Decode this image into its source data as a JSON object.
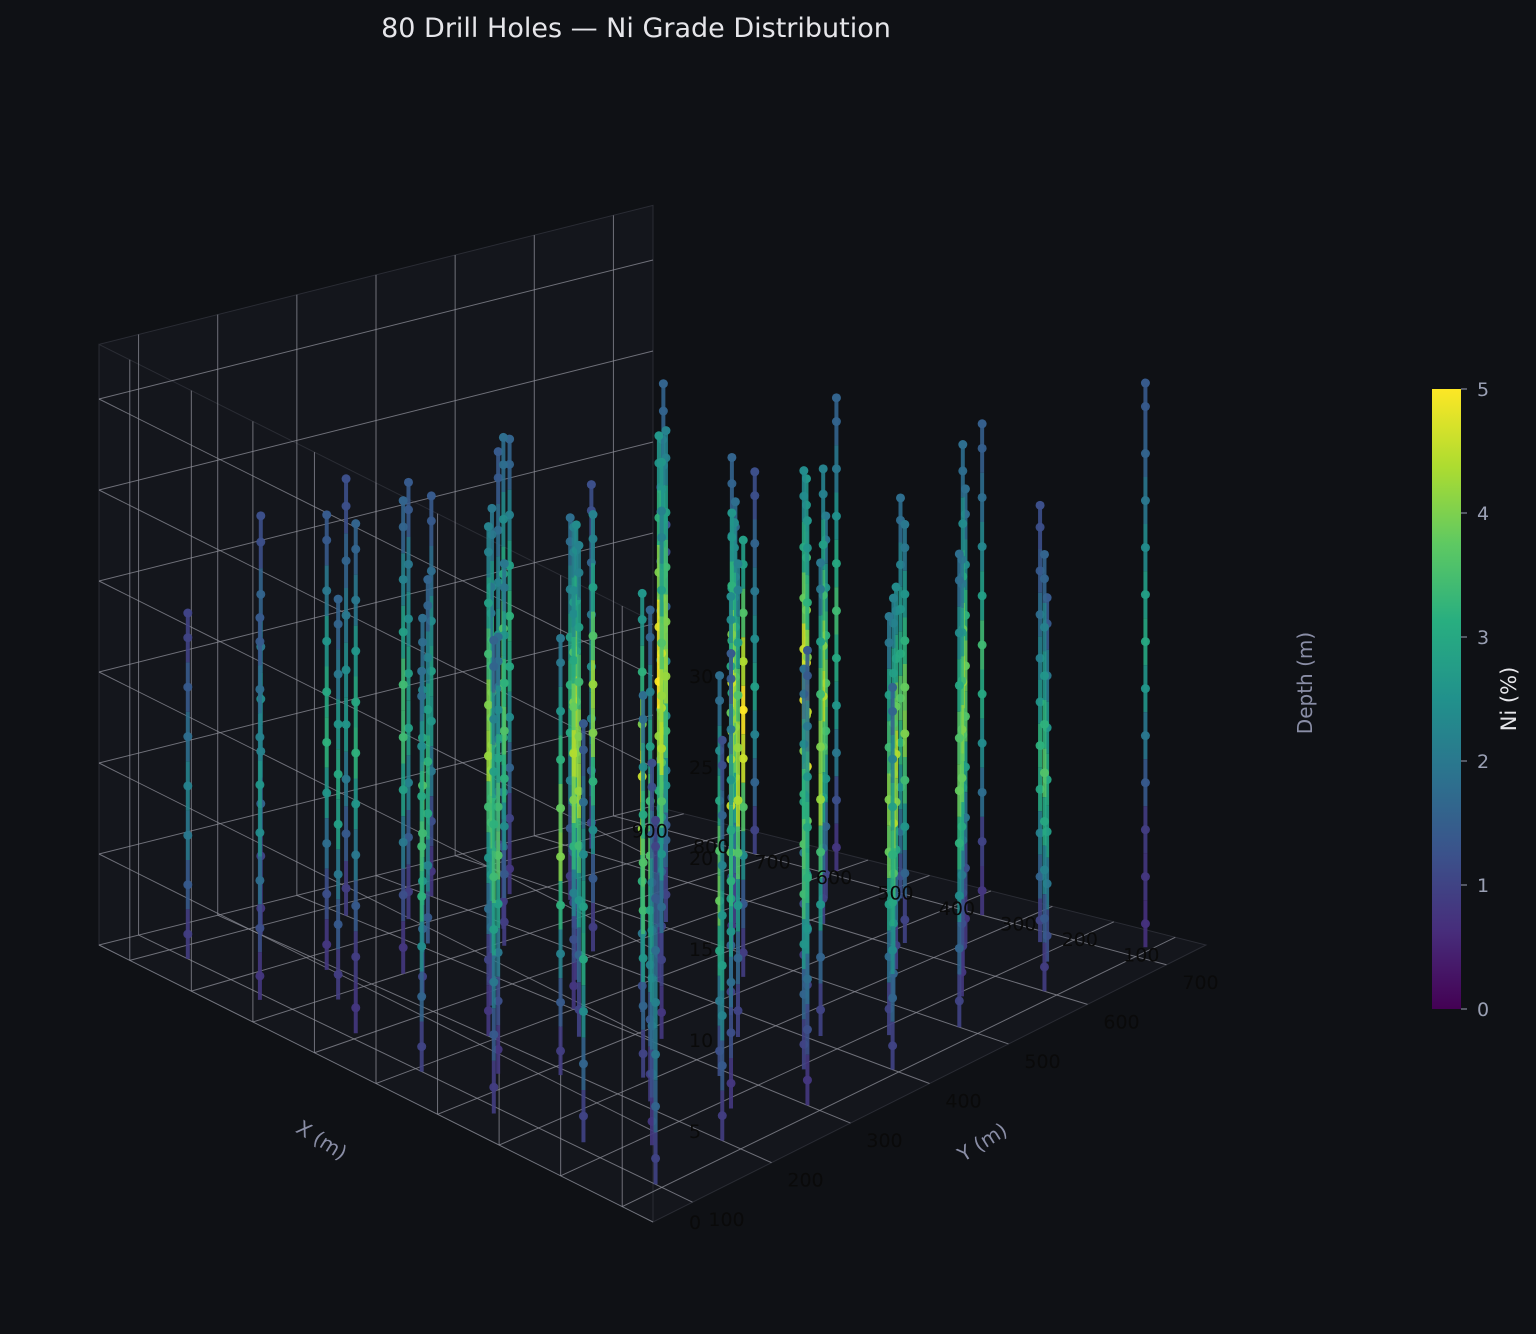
{
  "chart_data": {
    "type": "scatter",
    "title": "80 Drill Holes — Ni Grade Distribution",
    "xlabel": "X (m)",
    "ylabel": "Y (m)",
    "zlabel": "Depth (m)",
    "x_ticks": [
      "100",
      "200",
      "300",
      "400",
      "500",
      "600",
      "700",
      "800",
      "900"
    ],
    "y_ticks": [
      "100",
      "200",
      "300",
      "400",
      "500",
      "600",
      "700"
    ],
    "z_ticks": [
      "0",
      "5",
      "10",
      "15",
      "20",
      "25",
      "30"
    ],
    "xlim": [
      50,
      950
    ],
    "ylim": [
      50,
      750
    ],
    "zlim": [
      0,
      33
    ],
    "grid": true,
    "colormap": "viridis",
    "colorbar": {
      "label": "Ni (%)",
      "ticks": [
        "0",
        "1",
        "2",
        "3",
        "4",
        "5"
      ],
      "range": [
        0,
        5
      ]
    },
    "holes": [
      {
        "x": 110,
        "y": 720,
        "depth": 31,
        "ni": [
          1.4,
          1.6,
          2.0,
          2.4,
          2.8,
          3.0,
          2.6,
          2.0,
          1.4,
          0.9,
          0.8,
          0.7
        ]
      },
      {
        "x": 230,
        "y": 680,
        "depth": 24,
        "ni": [
          1.2,
          1.4,
          1.8,
          2.2,
          2.6,
          3.2,
          3.0,
          2.2,
          1.6,
          1.0
        ]
      },
      {
        "x": 350,
        "y": 700,
        "depth": 27,
        "ni": [
          1.5,
          1.8,
          2.3,
          2.8,
          3.4,
          3.0,
          2.4,
          1.8,
          1.0,
          0.8
        ]
      },
      {
        "x": 470,
        "y": 690,
        "depth": 22,
        "ni": [
          1.8,
          2.2,
          2.6,
          3.0,
          3.6,
          3.2,
          2.5,
          1.8,
          1.2
        ]
      },
      {
        "x": 600,
        "y": 710,
        "depth": 26,
        "ni": [
          1.6,
          2.0,
          2.5,
          3.0,
          3.4,
          3.0,
          2.6,
          2.0,
          1.2,
          0.8
        ]
      },
      {
        "x": 720,
        "y": 700,
        "depth": 21,
        "ni": [
          1.2,
          1.6,
          2.0,
          2.4,
          2.8,
          2.2,
          1.6,
          1.0
        ]
      },
      {
        "x": 860,
        "y": 690,
        "depth": 19,
        "ni": [
          1.0,
          1.4,
          1.8,
          2.2,
          2.0,
          1.6,
          1.0
        ]
      },
      {
        "x": 120,
        "y": 600,
        "depth": 24,
        "ni": [
          1.6,
          2.2,
          2.6,
          3.2,
          3.6,
          3.0,
          2.2,
          1.4,
          0.9
        ]
      },
      {
        "x": 240,
        "y": 590,
        "depth": 29,
        "ni": [
          1.8,
          2.4,
          3.0,
          3.8,
          4.2,
          3.6,
          2.8,
          2.0,
          1.2,
          0.9
        ]
      },
      {
        "x": 360,
        "y": 610,
        "depth": 23,
        "ni": [
          2.0,
          2.6,
          3.2,
          3.8,
          4.0,
          3.4,
          2.6,
          1.6,
          1.0
        ]
      },
      {
        "x": 480,
        "y": 600,
        "depth": 25,
        "ni": [
          2.2,
          2.8,
          3.4,
          4.0,
          4.4,
          3.6,
          2.8,
          1.8,
          1.0
        ]
      },
      {
        "x": 610,
        "y": 590,
        "depth": 22,
        "ni": [
          1.8,
          2.4,
          3.0,
          3.6,
          3.8,
          3.0,
          2.2,
          1.2
        ]
      },
      {
        "x": 740,
        "y": 600,
        "depth": 27,
        "ni": [
          1.6,
          2.0,
          2.6,
          3.2,
          3.4,
          2.8,
          2.0,
          1.4,
          0.9
        ]
      },
      {
        "x": 870,
        "y": 610,
        "depth": 20,
        "ni": [
          1.2,
          1.6,
          2.0,
          2.4,
          2.2,
          1.6,
          1.0
        ]
      },
      {
        "x": 130,
        "y": 500,
        "depth": 26,
        "ni": [
          1.8,
          2.4,
          3.0,
          3.6,
          3.8,
          3.2,
          2.4,
          1.6,
          1.0
        ]
      },
      {
        "x": 250,
        "y": 510,
        "depth": 22,
        "ni": [
          2.2,
          2.8,
          3.6,
          4.2,
          4.4,
          3.6,
          2.6,
          1.6
        ]
      },
      {
        "x": 370,
        "y": 490,
        "depth": 28,
        "ni": [
          2.4,
          3.0,
          3.8,
          4.6,
          4.8,
          4.0,
          3.0,
          2.0,
          1.2,
          0.9
        ]
      },
      {
        "x": 500,
        "y": 500,
        "depth": 24,
        "ni": [
          2.6,
          3.2,
          4.0,
          4.6,
          4.2,
          3.4,
          2.4,
          1.4,
          0.9
        ]
      },
      {
        "x": 620,
        "y": 510,
        "depth": 27,
        "ni": [
          2.2,
          2.8,
          3.4,
          4.0,
          4.2,
          3.4,
          2.6,
          1.6,
          1.0
        ]
      },
      {
        "x": 750,
        "y": 490,
        "depth": 21,
        "ni": [
          1.8,
          2.2,
          2.8,
          3.2,
          3.0,
          2.2,
          1.4,
          0.9
        ]
      },
      {
        "x": 880,
        "y": 500,
        "depth": 23,
        "ni": [
          1.4,
          1.8,
          2.2,
          2.6,
          2.4,
          1.8,
          1.2,
          0.8
        ]
      },
      {
        "x": 110,
        "y": 400,
        "depth": 21,
        "ni": [
          1.6,
          2.2,
          2.8,
          3.2,
          3.0,
          2.4,
          1.6,
          1.0
        ]
      },
      {
        "x": 240,
        "y": 410,
        "depth": 26,
        "ni": [
          2.0,
          2.8,
          3.4,
          4.0,
          4.2,
          3.4,
          2.6,
          1.6,
          1.0
        ]
      },
      {
        "x": 360,
        "y": 390,
        "depth": 23,
        "ni": [
          2.4,
          3.0,
          3.8,
          4.4,
          4.6,
          3.8,
          2.8,
          1.6,
          1.0
        ]
      },
      {
        "x": 490,
        "y": 400,
        "depth": 30,
        "ni": [
          2.6,
          3.2,
          4.0,
          4.8,
          5.0,
          4.2,
          3.2,
          2.2,
          1.4,
          0.9
        ]
      },
      {
        "x": 610,
        "y": 410,
        "depth": 24,
        "ni": [
          2.2,
          2.8,
          3.6,
          4.2,
          4.0,
          3.2,
          2.4,
          1.4,
          0.9
        ]
      },
      {
        "x": 730,
        "y": 390,
        "depth": 27,
        "ni": [
          1.8,
          2.4,
          3.0,
          3.6,
          3.8,
          3.0,
          2.2,
          1.4,
          0.9
        ]
      },
      {
        "x": 860,
        "y": 400,
        "depth": 22,
        "ni": [
          1.4,
          1.8,
          2.4,
          2.8,
          2.6,
          2.0,
          1.2,
          0.8
        ]
      },
      {
        "x": 120,
        "y": 300,
        "depth": 25,
        "ni": [
          1.4,
          2.0,
          2.6,
          3.0,
          3.2,
          2.6,
          1.8,
          1.2,
          0.8
        ]
      },
      {
        "x": 250,
        "y": 290,
        "depth": 22,
        "ni": [
          1.8,
          2.4,
          3.0,
          3.6,
          3.8,
          3.0,
          2.0,
          1.2
        ]
      },
      {
        "x": 370,
        "y": 310,
        "depth": 29,
        "ni": [
          2.2,
          2.8,
          3.6,
          4.2,
          4.4,
          3.6,
          2.6,
          1.8,
          1.0,
          0.8
        ]
      },
      {
        "x": 500,
        "y": 300,
        "depth": 23,
        "ni": [
          2.4,
          3.0,
          3.8,
          4.4,
          4.0,
          3.2,
          2.2,
          1.2,
          0.8
        ]
      },
      {
        "x": 620,
        "y": 290,
        "depth": 26,
        "ni": [
          2.0,
          2.6,
          3.2,
          3.8,
          4.0,
          3.2,
          2.4,
          1.6,
          1.0
        ]
      },
      {
        "x": 750,
        "y": 310,
        "depth": 20,
        "ni": [
          1.6,
          2.2,
          2.8,
          3.2,
          3.0,
          2.2,
          1.4
        ]
      },
      {
        "x": 870,
        "y": 300,
        "depth": 24,
        "ni": [
          1.2,
          1.6,
          2.0,
          2.4,
          2.6,
          2.0,
          1.4,
          0.9
        ]
      },
      {
        "x": 130,
        "y": 200,
        "depth": 22,
        "ni": [
          1.2,
          1.6,
          2.2,
          2.6,
          2.8,
          2.2,
          1.4,
          0.9
        ]
      },
      {
        "x": 260,
        "y": 210,
        "depth": 27,
        "ni": [
          1.6,
          2.2,
          2.8,
          3.4,
          3.6,
          3.0,
          2.2,
          1.4,
          0.9
        ]
      },
      {
        "x": 380,
        "y": 190,
        "depth": 24,
        "ni": [
          2.0,
          2.6,
          3.2,
          3.8,
          4.0,
          3.2,
          2.2,
          1.4,
          0.9
        ]
      },
      {
        "x": 510,
        "y": 200,
        "depth": 28,
        "ni": [
          2.2,
          2.8,
          3.4,
          4.0,
          4.2,
          3.4,
          2.6,
          1.8,
          1.0,
          0.8
        ]
      },
      {
        "x": 630,
        "y": 210,
        "depth": 21,
        "ni": [
          1.8,
          2.4,
          3.0,
          3.6,
          3.4,
          2.6,
          1.6,
          1.0
        ]
      },
      {
        "x": 760,
        "y": 190,
        "depth": 25,
        "ni": [
          1.4,
          2.0,
          2.6,
          3.0,
          3.2,
          2.6,
          1.8,
          1.2,
          0.8
        ]
      },
      {
        "x": 880,
        "y": 200,
        "depth": 23,
        "ni": [
          1.2,
          1.6,
          2.0,
          2.4,
          2.2,
          1.6,
          1.0,
          0.8
        ]
      },
      {
        "x": 110,
        "y": 100,
        "depth": 20,
        "ni": [
          1.0,
          1.4,
          1.8,
          2.2,
          2.0,
          1.6,
          1.0
        ]
      },
      {
        "x": 240,
        "y": 110,
        "depth": 23,
        "ni": [
          1.4,
          1.8,
          2.4,
          2.8,
          3.0,
          2.4,
          1.6,
          1.0
        ]
      },
      {
        "x": 360,
        "y": 90,
        "depth": 26,
        "ni": [
          1.6,
          2.2,
          2.8,
          3.2,
          3.4,
          2.8,
          2.0,
          1.4,
          0.9
        ]
      },
      {
        "x": 490,
        "y": 100,
        "depth": 22,
        "ni": [
          1.8,
          2.4,
          3.0,
          3.4,
          3.2,
          2.4,
          1.6,
          1.0
        ]
      },
      {
        "x": 610,
        "y": 110,
        "depth": 28,
        "ni": [
          1.6,
          2.0,
          2.6,
          3.0,
          3.2,
          2.6,
          2.0,
          1.4,
          0.9,
          0.8
        ]
      },
      {
        "x": 740,
        "y": 90,
        "depth": 21,
        "ni": [
          1.4,
          1.8,
          2.2,
          2.6,
          2.4,
          1.8,
          1.2,
          0.8
        ]
      },
      {
        "x": 870,
        "y": 100,
        "depth": 19,
        "ni": [
          1.0,
          1.4,
          1.8,
          2.2,
          2.0,
          1.4,
          0.9
        ]
      },
      {
        "x": 180,
        "y": 650,
        "depth": 20,
        "ni": [
          1.4,
          2.0,
          2.6,
          3.0,
          2.8,
          2.0,
          1.2
        ]
      },
      {
        "x": 300,
        "y": 640,
        "depth": 25,
        "ni": [
          1.8,
          2.4,
          3.2,
          3.8,
          3.6,
          2.8,
          2.0,
          1.2,
          0.8
        ]
      },
      {
        "x": 540,
        "y": 650,
        "depth": 21,
        "ni": [
          2.0,
          2.6,
          3.2,
          3.6,
          3.4,
          2.6,
          1.6,
          1.0
        ]
      },
      {
        "x": 680,
        "y": 640,
        "depth": 23,
        "ni": [
          1.6,
          2.2,
          2.8,
          3.2,
          3.0,
          2.2,
          1.4,
          0.9
        ]
      },
      {
        "x": 800,
        "y": 650,
        "depth": 18,
        "ni": [
          1.2,
          1.6,
          2.2,
          2.4,
          2.0,
          1.4
        ]
      },
      {
        "x": 190,
        "y": 550,
        "depth": 24,
        "ni": [
          2.0,
          2.6,
          3.4,
          4.0,
          3.8,
          3.0,
          2.0,
          1.2,
          0.8
        ]
      },
      {
        "x": 310,
        "y": 560,
        "depth": 21,
        "ni": [
          2.4,
          3.0,
          3.8,
          4.4,
          4.0,
          3.0,
          1.8,
          1.0
        ]
      },
      {
        "x": 430,
        "y": 540,
        "depth": 26,
        "ni": [
          2.6,
          3.4,
          4.2,
          4.8,
          4.4,
          3.4,
          2.4,
          1.4,
          0.9
        ]
      },
      {
        "x": 560,
        "y": 550,
        "depth": 22,
        "ni": [
          2.4,
          3.0,
          3.8,
          4.2,
          3.8,
          2.8,
          1.8,
          1.0
        ]
      },
      {
        "x": 690,
        "y": 560,
        "depth": 25,
        "ni": [
          2.0,
          2.6,
          3.2,
          3.8,
          3.6,
          2.8,
          2.0,
          1.2,
          0.8
        ]
      },
      {
        "x": 820,
        "y": 550,
        "depth": 19,
        "ni": [
          1.4,
          1.8,
          2.4,
          2.8,
          2.4,
          1.6,
          1.0
        ]
      },
      {
        "x": 180,
        "y": 450,
        "depth": 23,
        "ni": [
          2.0,
          2.8,
          3.4,
          4.0,
          3.8,
          2.8,
          1.8,
          1.0
        ]
      },
      {
        "x": 300,
        "y": 440,
        "depth": 27,
        "ni": [
          2.6,
          3.2,
          4.0,
          4.6,
          4.8,
          3.8,
          2.8,
          1.8,
          1.0
        ]
      },
      {
        "x": 430,
        "y": 460,
        "depth": 24,
        "ni": [
          2.8,
          3.6,
          4.4,
          5.0,
          4.6,
          3.6,
          2.4,
          1.4,
          0.9
        ]
      },
      {
        "x": 550,
        "y": 450,
        "depth": 27,
        "ni": [
          2.6,
          3.2,
          4.0,
          4.6,
          4.4,
          3.6,
          2.6,
          1.6,
          1.0
        ]
      },
      {
        "x": 680,
        "y": 440,
        "depth": 22,
        "ni": [
          2.2,
          2.8,
          3.6,
          4.0,
          3.6,
          2.6,
          1.6,
          1.0
        ]
      },
      {
        "x": 810,
        "y": 460,
        "depth": 25,
        "ni": [
          1.6,
          2.2,
          2.8,
          3.2,
          3.0,
          2.4,
          1.6,
          1.0,
          0.8
        ]
      },
      {
        "x": 190,
        "y": 350,
        "depth": 22,
        "ni": [
          1.8,
          2.4,
          3.2,
          3.6,
          3.4,
          2.6,
          1.6,
          1.0
        ]
      },
      {
        "x": 310,
        "y": 360,
        "depth": 26,
        "ni": [
          2.2,
          2.8,
          3.6,
          4.2,
          4.4,
          3.6,
          2.6,
          1.6,
          1.0
        ]
      },
      {
        "x": 440,
        "y": 340,
        "depth": 23,
        "ni": [
          2.6,
          3.2,
          4.0,
          4.6,
          4.2,
          3.2,
          2.0,
          1.2
        ]
      },
      {
        "x": 560,
        "y": 350,
        "depth": 25,
        "ni": [
          2.4,
          3.0,
          3.8,
          4.4,
          4.2,
          3.4,
          2.4,
          1.4,
          0.9
        ]
      },
      {
        "x": 690,
        "y": 360,
        "depth": 21,
        "ni": [
          2.0,
          2.6,
          3.2,
          3.6,
          3.2,
          2.4,
          1.4,
          0.9
        ]
      },
      {
        "x": 820,
        "y": 340,
        "depth": 24,
        "ni": [
          1.4,
          2.0,
          2.4,
          2.8,
          2.8,
          2.2,
          1.4,
          0.9
        ]
      },
      {
        "x": 180,
        "y": 250,
        "depth": 25,
        "ni": [
          1.4,
          2.0,
          2.6,
          3.0,
          3.2,
          2.6,
          1.8,
          1.2,
          0.8
        ]
      },
      {
        "x": 310,
        "y": 240,
        "depth": 21,
        "ni": [
          1.8,
          2.4,
          3.0,
          3.6,
          3.4,
          2.6,
          1.6,
          1.0
        ]
      },
      {
        "x": 440,
        "y": 260,
        "depth": 27,
        "ni": [
          2.2,
          2.8,
          3.4,
          4.0,
          4.2,
          3.4,
          2.6,
          1.6,
          1.0
        ]
      },
      {
        "x": 570,
        "y": 250,
        "depth": 23,
        "ni": [
          2.0,
          2.6,
          3.2,
          3.8,
          3.6,
          2.8,
          1.8,
          1.0
        ]
      },
      {
        "x": 700,
        "y": 240,
        "depth": 26,
        "ni": [
          1.6,
          2.2,
          2.8,
          3.4,
          3.4,
          2.8,
          2.0,
          1.2,
          0.8
        ]
      },
      {
        "x": 180,
        "y": 150,
        "depth": 21,
        "ni": [
          1.2,
          1.6,
          2.2,
          2.6,
          2.4,
          1.8,
          1.2,
          0.8
        ]
      },
      {
        "x": 430,
        "y": 150,
        "depth": 24,
        "ni": [
          1.8,
          2.4,
          3.0,
          3.4,
          3.6,
          2.8,
          2.0,
          1.2,
          0.8
        ]
      },
      {
        "x": 690,
        "y": 150,
        "depth": 22,
        "ni": [
          1.6,
          2.0,
          2.6,
          3.0,
          2.8,
          2.0,
          1.4,
          0.9
        ]
      }
    ]
  }
}
